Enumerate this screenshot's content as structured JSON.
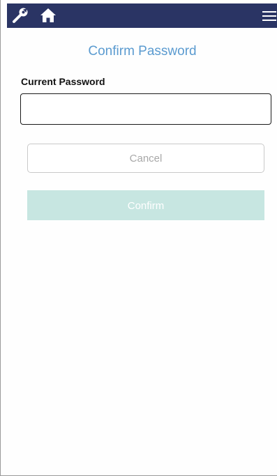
{
  "header": {
    "background_color": "#2a3464",
    "icons": {
      "settings": "wrench-icon",
      "home": "home-icon",
      "menu": "hamburger-menu-icon"
    }
  },
  "page": {
    "title": "Confirm Password",
    "title_color": "#5b9bd0"
  },
  "form": {
    "current_password_label": "Current Password",
    "current_password_value": "",
    "current_password_placeholder": ""
  },
  "actions": {
    "cancel_label": "Cancel",
    "confirm_label": "Confirm",
    "confirm_color": "#c7e6e1"
  }
}
